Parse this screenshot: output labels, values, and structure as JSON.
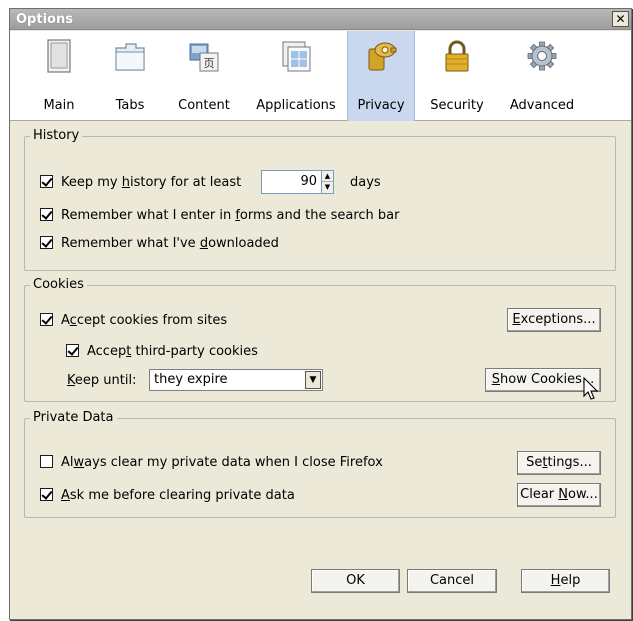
{
  "window": {
    "title": "Options",
    "close_glyph": "✕"
  },
  "toolbar": {
    "items": [
      {
        "label": "Main",
        "icon": "main-icon"
      },
      {
        "label": "Tabs",
        "icon": "tabs-icon"
      },
      {
        "label": "Content",
        "icon": "content-icon"
      },
      {
        "label": "Applications",
        "icon": "applications-icon"
      },
      {
        "label": "Privacy",
        "icon": "privacy-icon",
        "selected": true
      },
      {
        "label": "Security",
        "icon": "security-icon"
      },
      {
        "label": "Advanced",
        "icon": "advanced-icon"
      }
    ]
  },
  "history": {
    "label": "History",
    "keep_history": {
      "pre": "Keep my ",
      "u": "h",
      "post": "istory for at least",
      "checked": true
    },
    "days_value": "90",
    "days_label": "days",
    "remember_forms": {
      "pre": "Remember what I enter in ",
      "u": "f",
      "post": "orms and the search bar",
      "checked": true
    },
    "remember_downloads": {
      "pre": "Remember what I've ",
      "u": "d",
      "post": "ownloaded",
      "checked": true
    }
  },
  "cookies": {
    "label": "Cookies",
    "accept_cookies": {
      "pre": "A",
      "u": "c",
      "post": "cept cookies from sites",
      "checked": true
    },
    "accept_third_party": {
      "pre": "Accep",
      "u": "t",
      "post": " third-party cookies",
      "checked": true
    },
    "keep_until_label": {
      "pre": "",
      "u": "K",
      "post": "eep until:"
    },
    "keep_until_value": "they expire",
    "exceptions_button": {
      "pre": "",
      "u": "E",
      "post": "xceptions..."
    },
    "show_cookies_button": {
      "pre": "",
      "u": "S",
      "post": "how Cookies..."
    }
  },
  "private_data": {
    "label": "Private Data",
    "always_clear": {
      "pre": "Al",
      "u": "w",
      "post": "ays clear my private data when I close Firefox",
      "checked": false
    },
    "ask_before": {
      "pre": "",
      "u": "A",
      "post": "sk me before clearing private data",
      "checked": true
    },
    "settings_button": {
      "pre": "Se",
      "u": "t",
      "post": "tings..."
    },
    "clear_now_button": {
      "pre": "Clear ",
      "u": "N",
      "post": "ow..."
    }
  },
  "footer": {
    "ok_label": "OK",
    "cancel_label": "Cancel",
    "help_button": {
      "pre": "",
      "u": "H",
      "post": "elp"
    }
  },
  "colors": {
    "accent": "#c9d8ef",
    "dialog_bg": "#ece9d8"
  }
}
